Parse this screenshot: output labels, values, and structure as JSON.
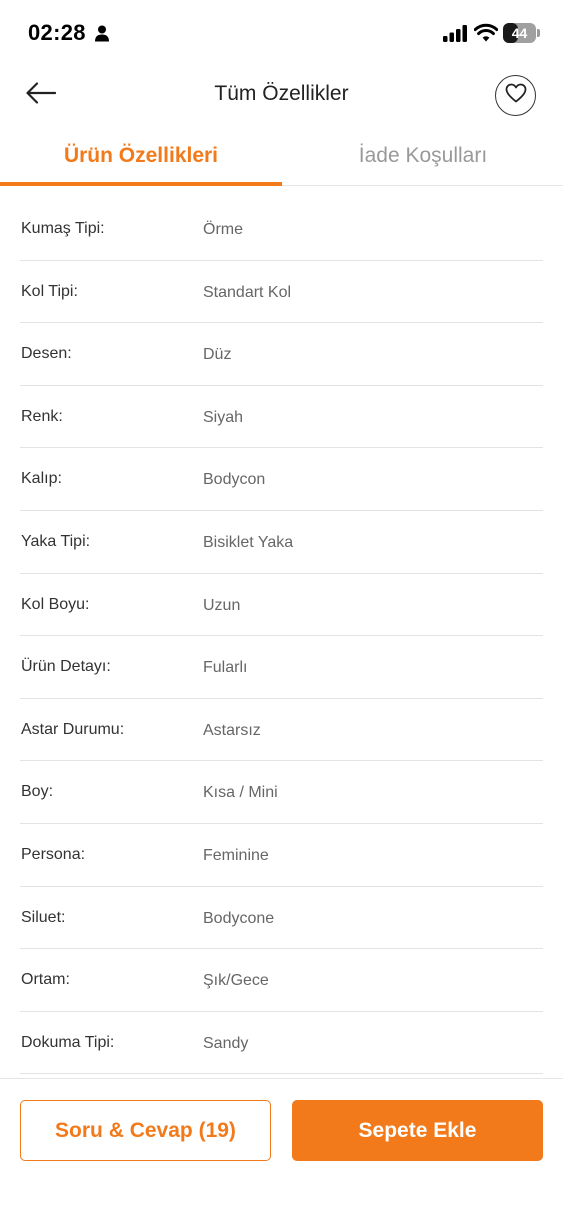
{
  "status_bar": {
    "time": "02:28",
    "battery_label": "44",
    "battery_level": 0.44,
    "icons": [
      "person-icon",
      "signal-icon",
      "wifi-icon",
      "battery-icon"
    ]
  },
  "header": {
    "title": "Tüm Özellikler",
    "back_icon": "arrow-left-icon",
    "favorite_icon": "heart-icon"
  },
  "tabs": [
    {
      "label": "Ürün Özellikleri",
      "active": true
    },
    {
      "label": "İade Koşulları",
      "active": false
    }
  ],
  "properties": [
    {
      "label": "Kumaş Tipi:",
      "value": "Örme"
    },
    {
      "label": "Kol Tipi:",
      "value": "Standart Kol"
    },
    {
      "label": "Desen:",
      "value": "Düz"
    },
    {
      "label": "Renk:",
      "value": "Siyah"
    },
    {
      "label": "Kalıp:",
      "value": "Bodycon"
    },
    {
      "label": "Yaka Tipi:",
      "value": "Bisiklet Yaka"
    },
    {
      "label": "Kol Boyu:",
      "value": "Uzun"
    },
    {
      "label": "Ürün Detayı:",
      "value": "Fularlı"
    },
    {
      "label": "Astar Durumu:",
      "value": "Astarsız"
    },
    {
      "label": "Boy:",
      "value": "Kısa / Mini"
    },
    {
      "label": "Persona:",
      "value": "Feminine"
    },
    {
      "label": "Siluet:",
      "value": "Bodycone"
    },
    {
      "label": "Ortam:",
      "value": "Şık/Gece"
    },
    {
      "label": "Dokuma Tipi:",
      "value": "Sandy"
    }
  ],
  "bottom_bar": {
    "qa_label": "Soru & Cevap (19)",
    "cart_label": "Sepete Ekle"
  },
  "colors": {
    "accent": "#f27a1a",
    "text": "#333333",
    "muted": "#999999",
    "divider": "#e3e3e3"
  }
}
